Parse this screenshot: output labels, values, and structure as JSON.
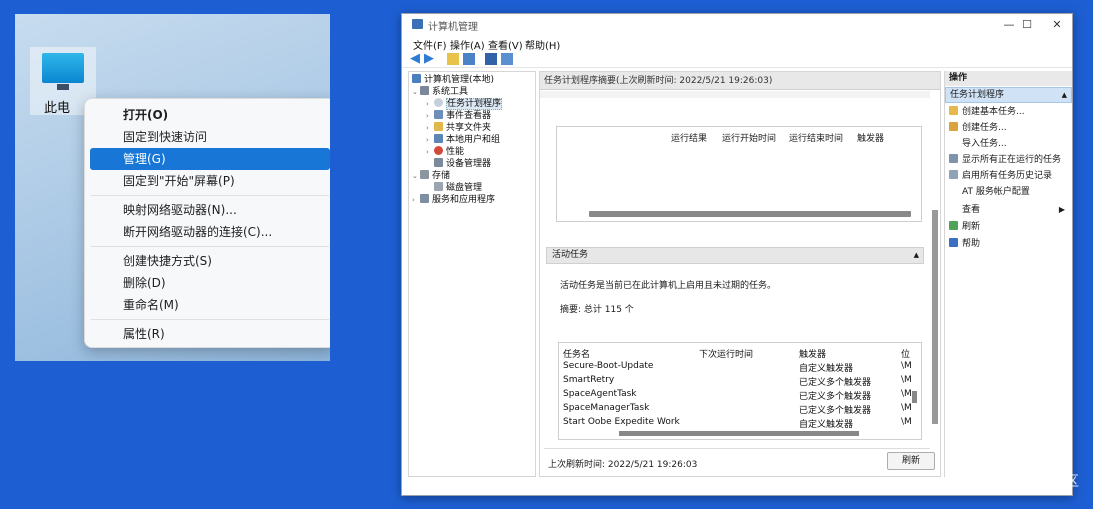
{
  "desktop": {
    "icon_label": "此电",
    "context_menu": {
      "items": [
        {
          "label": "打开(O)"
        },
        {
          "label": "固定到快速访问"
        },
        {
          "label": "管理(G)"
        },
        {
          "label": "固定到\"开始\"屏幕(P)"
        },
        {
          "label": "映射网络驱动器(N)..."
        },
        {
          "label": "断开网络驱动器的连接(C)..."
        },
        {
          "label": "创建快捷方式(S)"
        },
        {
          "label": "删除(D)"
        },
        {
          "label": "重命名(M)"
        },
        {
          "label": "属性(R)"
        }
      ],
      "selected": "管理(G)"
    }
  },
  "window": {
    "title": "计算机管理",
    "controls": {
      "minimize": "—",
      "maximize": "☐",
      "close": "✕"
    },
    "menu": [
      "文件(F)",
      "操作(A)",
      "查看(V)",
      "帮助(H)"
    ],
    "tree": {
      "root": "计算机管理(本地)",
      "items": [
        {
          "label": "系统工具",
          "arrow": "⌄"
        },
        {
          "label": "任务计划程序",
          "arrow": "›"
        },
        {
          "label": "事件查看器",
          "arrow": "›"
        },
        {
          "label": "共享文件夹",
          "arrow": "›"
        },
        {
          "label": "本地用户和组",
          "arrow": "›"
        },
        {
          "label": "性能",
          "arrow": "›"
        },
        {
          "label": "设备管理器",
          "arrow": ""
        },
        {
          "label": "存储",
          "arrow": "⌄"
        },
        {
          "label": "磁盘管理",
          "arrow": ""
        },
        {
          "label": "服务和应用程序",
          "arrow": "›"
        }
      ]
    },
    "middle": {
      "header": "任务计划程序摘要(上次刷新时间: 2022/5/21 19:26:03)",
      "top_columns": [
        "运行结果",
        "运行开始时间",
        "运行结束时间",
        "触发器"
      ],
      "active_tasks": {
        "header": "活动任务",
        "description": "活动任务是当前已在此计算机上启用且未过期的任务。",
        "summary": "摘要: 总计 115 个",
        "columns": [
          "任务名",
          "下次运行时间",
          "触发器",
          "位"
        ],
        "rows": [
          {
            "name": "Secure-Boot-Update",
            "trigger": "自定义触发器",
            "loc": "\\M"
          },
          {
            "name": "SmartRetry",
            "trigger": "已定义多个触发器",
            "loc": "\\M"
          },
          {
            "name": "SpaceAgentTask",
            "trigger": "已定义多个触发器",
            "loc": "\\M"
          },
          {
            "name": "SpaceManagerTask",
            "trigger": "已定义多个触发器",
            "loc": "\\M"
          },
          {
            "name": "Start Oobe Expedite Work",
            "trigger": "自定义触发器",
            "loc": "\\M"
          }
        ]
      },
      "last_refresh": "上次刷新时间: 2022/5/21 19:26:03",
      "refresh_label": "刷新"
    },
    "actions": {
      "title": "操作",
      "section": "任务计划程序",
      "items": [
        {
          "label": "创建基本任务..."
        },
        {
          "label": "创建任务..."
        },
        {
          "label": "导入任务..."
        },
        {
          "label": "显示所有正在运行的任务"
        },
        {
          "label": "启用所有任务历史记录"
        },
        {
          "label": "AT 服务帐户配置"
        },
        {
          "label": "查看"
        },
        {
          "label": "刷新"
        },
        {
          "label": "帮助"
        }
      ]
    }
  },
  "watermark": "@稀土掘金技术社区"
}
